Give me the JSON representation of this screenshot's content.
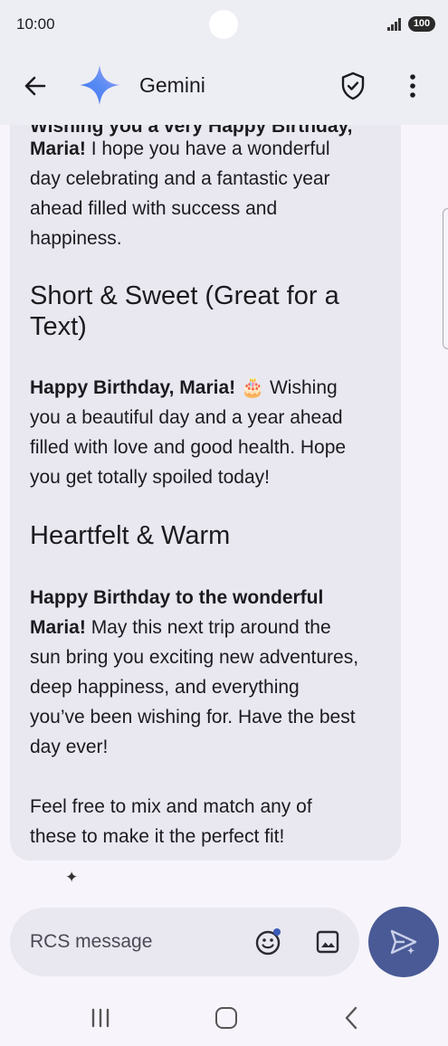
{
  "status_bar": {
    "time": "10:00",
    "battery": "100"
  },
  "app_bar": {
    "title": "Gemini"
  },
  "message": {
    "intro": {
      "partial_top": "Wishing you a very Happy Birthday,",
      "bold": "Maria!",
      "rest_line1": " I hope you have a wonderful",
      "line2": "day celebrating and a fantastic year",
      "line3": "ahead filled with success and",
      "line4": "happiness."
    },
    "short_sweet": {
      "heading_line1": "Short & Sweet (Great for a",
      "heading_line2": "Text)",
      "bold": "Happy Birthday, Maria!",
      "emoji": "🎂",
      "rest_line1": " Wishing",
      "line2": "you a beautiful day and a year ahead",
      "line3": "filled with love and good health. Hope",
      "line4": "you get totally spoiled today!"
    },
    "heartfelt": {
      "heading": "Heartfelt & Warm",
      "bold_line1": "Happy Birthday to the wonderful",
      "bold_line2": "Maria!",
      "rest_line2": " May this next trip around the",
      "line3": "sun bring you exciting new adventures,",
      "line4": "deep happiness, and everything",
      "line5": "you’ve been wishing for. Have the best",
      "line6": "day ever!"
    },
    "closing": {
      "line1": "Feel free to mix and match any of",
      "line2": "these to make it the perfect fit!"
    }
  },
  "composer": {
    "placeholder": "RCS message"
  },
  "icons": {
    "back": "arrow-back-icon",
    "logo": "gemini-sparkle-logo",
    "shield": "shield-check-icon",
    "more": "more-vert-icon",
    "sparkle": "sparkle-icon",
    "emoji": "emoji-icon",
    "gallery": "gallery-icon",
    "send": "send-icon"
  },
  "colors": {
    "send_button": "#4a5a96",
    "bubble": "#e9e7f0",
    "app_bar": "#ededf4"
  }
}
